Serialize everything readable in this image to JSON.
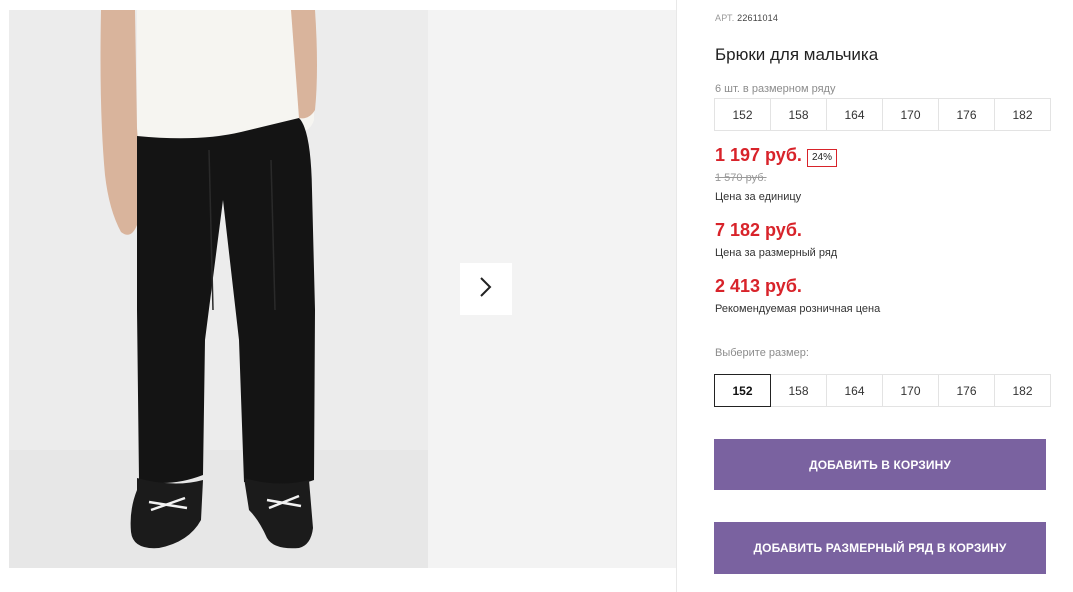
{
  "gallery": {
    "next_icon": "chevron-right-icon",
    "colors": {
      "background": "#ececec",
      "pants": "#141414",
      "shirt": "#f6f5f1"
    }
  },
  "product": {
    "article_label": "АРТ.",
    "article_number": "22611014",
    "title": "Брюки для мальчика",
    "pack_info": "6 шт. в размерном ряду",
    "pack_sizes": [
      "152",
      "158",
      "164",
      "170",
      "176",
      "182"
    ],
    "price": "1 197 руб.",
    "discount": "24%",
    "old_price": "1 570 руб.",
    "unit_price_label": "Цена за единицу",
    "pack_price": "7 182 руб.",
    "pack_price_label": "Цена за размерный ряд",
    "retail_price": "2 413 руб.",
    "retail_price_label": "Рекомендуемая розничная цена",
    "choose_size_label": "Выберите размер:",
    "sizes": [
      "152",
      "158",
      "164",
      "170",
      "176",
      "182"
    ],
    "selected_size": "152"
  },
  "actions": {
    "add_to_cart": "ДОБАВИТЬ В КОРЗИНУ",
    "add_pack_to_cart": "ДОБАВИТЬ РАЗМЕРНЫЙ РЯД В КОРЗИНУ"
  },
  "colors": {
    "accent": "#7a62a0",
    "price": "#d8232a"
  }
}
